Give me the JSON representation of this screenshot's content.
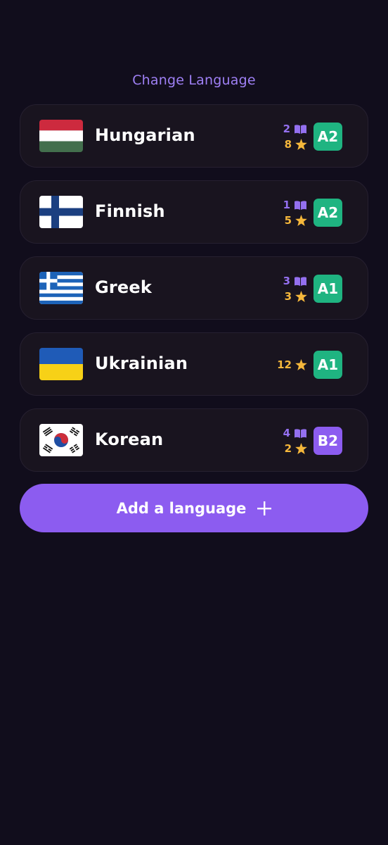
{
  "header": {
    "title": "Change Language"
  },
  "colors": {
    "accent": "#8c5cf0",
    "level_green": "#1fb481",
    "level_purple": "#8c5cf0",
    "words": "#9470f0",
    "stars": "#f5b73b"
  },
  "languages": [
    {
      "name": "Hungarian",
      "flag": "hungary-flag-icon",
      "words": "2",
      "stars": "8",
      "level": "A2",
      "level_color": "green"
    },
    {
      "name": "Finnish",
      "flag": "finland-flag-icon",
      "words": "1",
      "stars": "5",
      "level": "A2",
      "level_color": "green"
    },
    {
      "name": "Greek",
      "flag": "greece-flag-icon",
      "words": "3",
      "stars": "3",
      "level": "A1",
      "level_color": "green"
    },
    {
      "name": "Ukrainian",
      "flag": "ukraine-flag-icon",
      "words": null,
      "stars": "12",
      "level": "A1",
      "level_color": "green"
    },
    {
      "name": "Korean",
      "flag": "south-korea-flag-icon",
      "words": "4",
      "stars": "2",
      "level": "B2",
      "level_color": "purple"
    }
  ],
  "add_button": {
    "label": "Add a language",
    "icon": "plus-icon"
  }
}
